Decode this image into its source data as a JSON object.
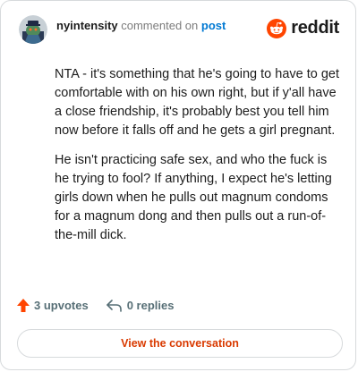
{
  "header": {
    "username": "nyintensity",
    "commented_text": "commented on",
    "post_link": "post"
  },
  "brand": {
    "wordmark": "reddit",
    "color": "#ff4500"
  },
  "comment": {
    "paragraphs": [
      "NTA - it's something that he's going to have to get comfortable with on his own right, but if y'all have a close friendship, it's probably best you tell him now before it falls off and he gets a girl pregnant.",
      "He isn't practicing safe sex, and who the fuck is he trying to fool? If anything, I expect he's letting girls down when he pulls out magnum condoms for a magnum dong and then pulls out a run-of-the-mill dick."
    ]
  },
  "actions": {
    "upvotes": "3 upvotes",
    "replies": "0 replies",
    "upvote_color": "#ff4500"
  },
  "cta": {
    "label": "View the conversation",
    "color": "#d93a00"
  },
  "icons": {
    "avatar": "snoo-avatar",
    "brand": "reddit-logo-icon",
    "upvote": "upvote-arrow-icon",
    "reply": "reply-arrow-icon"
  }
}
